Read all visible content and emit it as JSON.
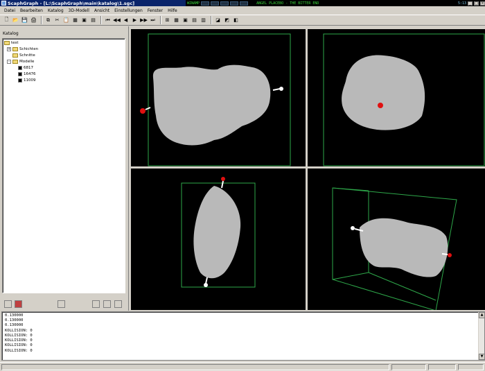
{
  "window": {
    "title": "ScaphGraph - [L:\\ScaphGraph\\main\\katalog\\1.sgc]",
    "tray_text_1": "WINAMP",
    "tray_text_2": "ANGEL PLACEBO - THE BITTER END",
    "tray_text_3": "5:13",
    "min": "_",
    "max": "□",
    "close": "×"
  },
  "menu": [
    "Datei",
    "Bearbeiten",
    "Katalog",
    "3D-Modell",
    "Ansicht",
    "Einstellungen",
    "Fenster",
    "Hilfe"
  ],
  "toolbar": {
    "new": "🗋",
    "open": "📂",
    "save": "💾",
    "print": "🖨",
    "copy": "⧉",
    "cut": "✂",
    "paste": "📋",
    "first": "⏮",
    "prev2": "◀◀",
    "prev": "◀",
    "next": "▶",
    "next2": "▶▶",
    "last": "⏭",
    "grid": "⊞",
    "view1": "▦",
    "view2": "▣",
    "view3": "▤",
    "view4": "▥",
    "render1": "◪",
    "render2": "◩",
    "render3": "◧"
  },
  "catalog": {
    "label": "Katalog",
    "tree": [
      {
        "label": "test",
        "level": 0,
        "kind": "folder",
        "expander": "-"
      },
      {
        "label": "Schichten",
        "level": 1,
        "kind": "folder",
        "expander": "+"
      },
      {
        "label": "Schnitte",
        "level": 1,
        "kind": "folder",
        "expander": ""
      },
      {
        "label": "Modelle",
        "level": 1,
        "kind": "folder",
        "expander": "-"
      },
      {
        "label": "6817",
        "level": 2,
        "kind": "model",
        "expander": ""
      },
      {
        "label": "16476",
        "level": 2,
        "kind": "model",
        "expander": ""
      },
      {
        "label": "11009",
        "level": 2,
        "kind": "model",
        "expander": ""
      }
    ]
  },
  "log": {
    "lines": [
      "0.130000",
      "0.130000",
      "0.130000",
      "KOLLISION: 0",
      "KOLLISION: 0",
      "KOLLISION: 0",
      "KOLLISION: 0",
      "KOLLISION: 0"
    ]
  },
  "colors": {
    "bbox": "#2ea84a",
    "model": "#b9b9b9",
    "marker_red": "#e01010",
    "marker_white": "#ffffff"
  }
}
